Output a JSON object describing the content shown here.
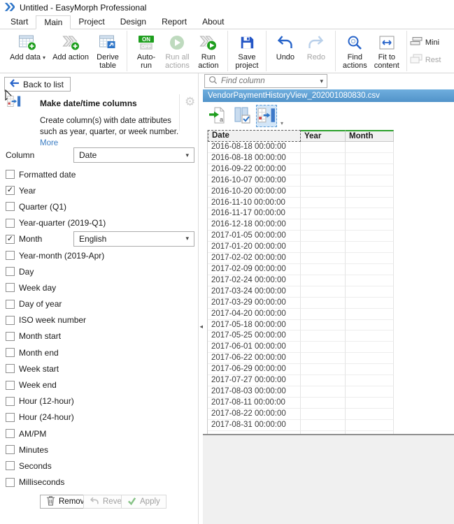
{
  "window": {
    "title": "Untitled - EasyMorph Professional"
  },
  "menu": {
    "tabs": [
      {
        "label": "Start",
        "active": false
      },
      {
        "label": "Main",
        "active": true
      },
      {
        "label": "Project",
        "active": false
      },
      {
        "label": "Design",
        "active": false
      },
      {
        "label": "Report",
        "active": false
      },
      {
        "label": "About",
        "active": false
      }
    ]
  },
  "toolbar": {
    "groups": [
      {
        "items": [
          {
            "name": "add-data",
            "icon": "table-add",
            "lines": [
              "Add data"
            ],
            "caret": true,
            "enabled": true
          },
          {
            "name": "add-action",
            "icon": "action-add",
            "lines": [
              "Add action"
            ],
            "enabled": true
          },
          {
            "name": "derive-table",
            "icon": "derive-table",
            "lines": [
              "Derive",
              "table"
            ],
            "enabled": true
          }
        ]
      },
      {
        "items": [
          {
            "name": "auto-run",
            "icon": "auto-run",
            "lines": [
              "Auto-",
              "run"
            ],
            "enabled": true
          },
          {
            "name": "run-all-actions",
            "icon": "run-all",
            "lines": [
              "Run all",
              "actions"
            ],
            "enabled": false
          },
          {
            "name": "run-action",
            "icon": "run-action",
            "lines": [
              "Run",
              "action"
            ],
            "enabled": true
          }
        ]
      },
      {
        "items": [
          {
            "name": "save-project",
            "icon": "save",
            "lines": [
              "Save",
              "project"
            ],
            "enabled": true
          }
        ]
      },
      {
        "items": [
          {
            "name": "undo",
            "icon": "undo",
            "lines": [
              "Undo"
            ],
            "enabled": true
          },
          {
            "name": "redo",
            "icon": "redo",
            "lines": [
              "Redo"
            ],
            "enabled": false
          }
        ]
      },
      {
        "items": [
          {
            "name": "find-actions",
            "icon": "find",
            "lines": [
              "Find",
              "actions"
            ],
            "enabled": true
          },
          {
            "name": "fit-to-content",
            "icon": "fit",
            "lines": [
              "Fit to",
              "content"
            ],
            "enabled": true
          }
        ]
      },
      {
        "vertical": true,
        "items": [
          {
            "name": "minimize-tables",
            "icon": "mini",
            "label": "Mini",
            "enabled": true
          },
          {
            "name": "restore-tables",
            "icon": "restore",
            "label": "Rest",
            "enabled": false
          }
        ]
      }
    ]
  },
  "left_panel": {
    "back_button": "Back to list",
    "action": {
      "title": "Make date/time columns",
      "description": "Create column(s) with date attributes such as year, quarter, or week number. ",
      "more_link": "More"
    },
    "column_label": "Column",
    "column_value": "Date",
    "month_language": "English",
    "checkboxes": [
      {
        "label": "Formatted date",
        "checked": false
      },
      {
        "label": "Year",
        "checked": true
      },
      {
        "label": "Quarter (Q1)",
        "checked": false
      },
      {
        "label": "Year-quarter (2019-Q1)",
        "checked": false
      },
      {
        "label": "Month",
        "checked": true,
        "dropdown": "English"
      },
      {
        "label": "Year-month (2019-Apr)",
        "checked": false
      },
      {
        "label": "Day",
        "checked": false
      },
      {
        "label": "Week day",
        "checked": false
      },
      {
        "label": "Day of year",
        "checked": false
      },
      {
        "label": "ISO week number",
        "checked": false
      },
      {
        "label": "Month start",
        "checked": false
      },
      {
        "label": "Month end",
        "checked": false
      },
      {
        "label": "Week start",
        "checked": false
      },
      {
        "label": "Week end",
        "checked": false
      },
      {
        "label": "Hour (12-hour)",
        "checked": false
      },
      {
        "label": "Hour (24-hour)",
        "checked": false
      },
      {
        "label": "AM/PM",
        "checked": false
      },
      {
        "label": "Minutes",
        "checked": false
      },
      {
        "label": "Seconds",
        "checked": false
      },
      {
        "label": "Milliseconds",
        "checked": false
      }
    ],
    "buttons": {
      "remove": "Remove",
      "revert": "Revert",
      "apply": "Apply"
    }
  },
  "right_panel": {
    "find_column_placeholder": "Find column",
    "dataset_tab": "VendorPaymentHistoryView_202001080830.csv",
    "table": {
      "columns": [
        "Date",
        "Year",
        "Month"
      ],
      "selected_column": "Date",
      "rows": [
        [
          "2016-08-18 00:00:00",
          "",
          ""
        ],
        [
          "2016-08-18 00:00:00",
          "",
          ""
        ],
        [
          "2016-09-22 00:00:00",
          "",
          ""
        ],
        [
          "2016-10-07 00:00:00",
          "",
          ""
        ],
        [
          "2016-10-20 00:00:00",
          "",
          ""
        ],
        [
          "2016-11-10 00:00:00",
          "",
          ""
        ],
        [
          "2016-11-17 00:00:00",
          "",
          ""
        ],
        [
          "2016-12-18 00:00:00",
          "",
          ""
        ],
        [
          "2017-01-05 00:00:00",
          "",
          ""
        ],
        [
          "2017-01-20 00:00:00",
          "",
          ""
        ],
        [
          "2017-02-02 00:00:00",
          "",
          ""
        ],
        [
          "2017-02-09 00:00:00",
          "",
          ""
        ],
        [
          "2017-02-24 00:00:00",
          "",
          ""
        ],
        [
          "2017-03-24 00:00:00",
          "",
          ""
        ],
        [
          "2017-03-29 00:00:00",
          "",
          ""
        ],
        [
          "2017-04-20 00:00:00",
          "",
          ""
        ],
        [
          "2017-05-18 00:00:00",
          "",
          ""
        ],
        [
          "2017-05-25 00:00:00",
          "",
          ""
        ],
        [
          "2017-06-01 00:00:00",
          "",
          ""
        ],
        [
          "2017-06-22 00:00:00",
          "",
          ""
        ],
        [
          "2017-06-29 00:00:00",
          "",
          ""
        ],
        [
          "2017-07-27 00:00:00",
          "",
          ""
        ],
        [
          "2017-08-03 00:00:00",
          "",
          ""
        ],
        [
          "2017-08-11 00:00:00",
          "",
          ""
        ],
        [
          "2017-08-22 00:00:00",
          "",
          ""
        ],
        [
          "2017-08-31 00:00:00",
          "",
          ""
        ],
        [
          "",
          "",
          ""
        ]
      ]
    }
  },
  "colors": {
    "accent_green": "#1e9e1e",
    "accent_blue": "#2e75c8",
    "tab_blue": "#5b9fd6",
    "new_column_green": "#2ba02b"
  }
}
